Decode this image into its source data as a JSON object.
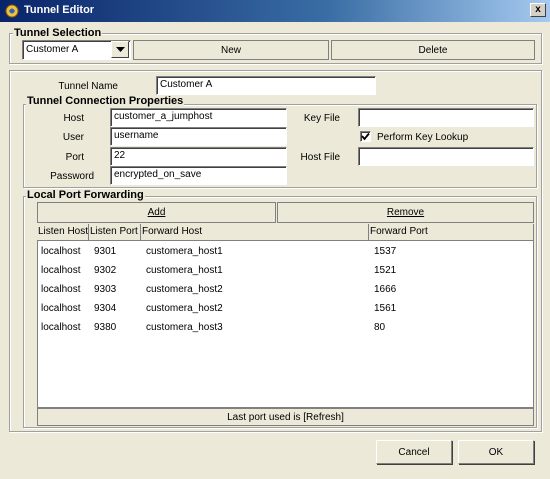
{
  "window": {
    "title": "Tunnel Editor",
    "close_glyph": "x"
  },
  "tunnel_selection": {
    "label": "Tunnel Selection",
    "selected": "Customer A",
    "new_label": "New",
    "delete_label": "Delete"
  },
  "tunnel": {
    "name_label": "Tunnel Name",
    "name_value": "Customer A"
  },
  "connection": {
    "label": "Tunnel Connection Properties",
    "host_label": "Host",
    "host_value": "customer_a_jumphost",
    "user_label": "User",
    "user_value": "username",
    "port_label": "Port",
    "port_value": "22",
    "password_label": "Password",
    "password_value": "encrypted_on_save",
    "keyfile_label": "Key File",
    "keyfile_value": "",
    "keylookup_label": "Perform Key Lookup",
    "keylookup_checked": true,
    "hostfile_label": "Host File",
    "hostfile_value": ""
  },
  "forwarding": {
    "label": "Local Port Forwarding",
    "add_label": "Add",
    "remove_label": "Remove",
    "columns": [
      "Listen Host",
      "Listen Port",
      "Forward Host",
      "Forward Port"
    ],
    "rows": [
      [
        "localhost",
        "9301",
        "customera_host1",
        "1537"
      ],
      [
        "localhost",
        "9302",
        "customera_host1",
        "1521"
      ],
      [
        "localhost",
        "9303",
        "customera_host2",
        "1666"
      ],
      [
        "localhost",
        "9304",
        "customera_host2",
        "1561"
      ],
      [
        "localhost",
        "9380",
        "customera_host3",
        "80"
      ]
    ],
    "status": "Last port used is [Refresh]"
  },
  "footer": {
    "cancel_label": "Cancel",
    "ok_label": "OK"
  }
}
